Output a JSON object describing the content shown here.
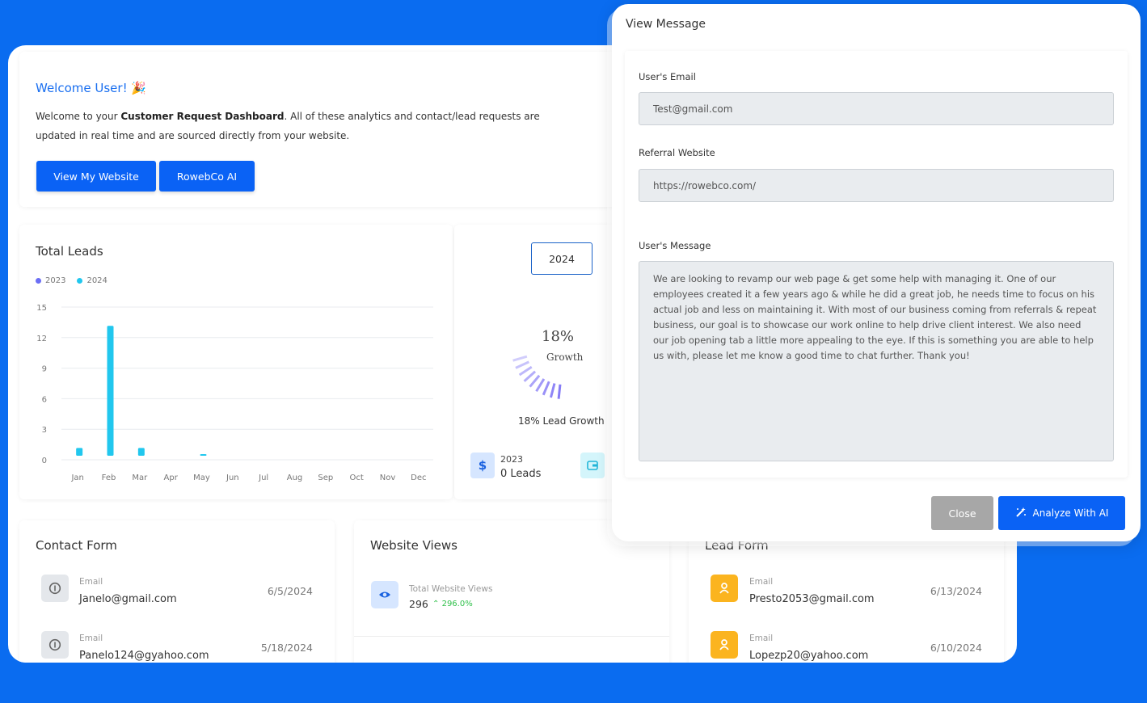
{
  "welcome": {
    "title": "Welcome User!",
    "intro_prefix": "Welcome to your ",
    "intro_bold": "Customer Request Dashboard",
    "intro_suffix": ". All of these analytics and contact/lead requests are updated in real time and are sourced directly from your website.",
    "btn_website": "View My Website",
    "btn_ai": "RowebCo AI"
  },
  "leads_card": {
    "title": "Total Leads"
  },
  "chart_data": {
    "type": "bar",
    "title": "Total Leads",
    "categories": [
      "Jan",
      "Feb",
      "Mar",
      "Apr",
      "May",
      "Jun",
      "Jul",
      "Aug",
      "Sep",
      "Oct",
      "Nov",
      "Dec"
    ],
    "series": [
      {
        "name": "2023",
        "color": "#6b6ef5",
        "values": [
          0,
          0,
          0,
          0,
          0,
          0,
          0,
          0,
          0,
          0,
          0,
          0
        ]
      },
      {
        "name": "2024",
        "color": "#21c7ee",
        "values": [
          1,
          13,
          1,
          0,
          0.4,
          0,
          0,
          0,
          0,
          0,
          0,
          0
        ]
      }
    ],
    "yticks": [
      0,
      3,
      6,
      9,
      12,
      15
    ],
    "ylim": [
      0,
      15
    ],
    "grid": true,
    "legend": "top-left"
  },
  "growth": {
    "year": "2024",
    "percent": "18%",
    "label": "Growth",
    "summary": "18% Lead Growth",
    "stat_year": "2023",
    "stat_value": "0 Leads"
  },
  "contact_form": {
    "title": "Contact Form",
    "rows": [
      {
        "label": "Email",
        "value": "Janelo@gmail.com",
        "date": "6/5/2024"
      },
      {
        "label": "Email",
        "value": "Panelo124@gyahoo.com",
        "date": "5/18/2024"
      }
    ]
  },
  "website_views": {
    "title": "Website Views",
    "label": "Total Website Views",
    "value": "296",
    "change": "296.0%"
  },
  "lead_form": {
    "title": "Lead Form",
    "rows": [
      {
        "label": "Email",
        "value": "Presto2053@gmail.com",
        "date": "6/13/2024"
      },
      {
        "label": "Email",
        "value": "Lopezp20@yahoo.com",
        "date": "6/10/2024"
      }
    ]
  },
  "modal": {
    "title": "View Message",
    "email_label": "User's Email",
    "email_value": "Test@gmail.com",
    "referral_label": "Referral Website",
    "referral_value": "https://rowebco.com/",
    "message_label": "User's Message",
    "message_value": "We are looking to revamp our web page & get some help with managing it. One of our employees created it a few years ago & while he did a great job, he needs time to focus on his actual job and less on maintaining it. With most of our business coming from referrals & repeat business, our goal is to showcase our work online to help drive client interest. We also need our job opening tab a little more appealing to the eye. If this is something you are able to help us with, please let me know a good time to chat further. Thank you!",
    "close_label": "Close",
    "analyze_label": "Analyze With AI"
  },
  "colors": {
    "background": "#0a6cf0",
    "primary": "#0a62f5",
    "accent_cyan": "#21c7ee",
    "accent_purple": "#6b6ef5",
    "lead_icon": "#fbb41f",
    "positive": "#2fc04a"
  }
}
